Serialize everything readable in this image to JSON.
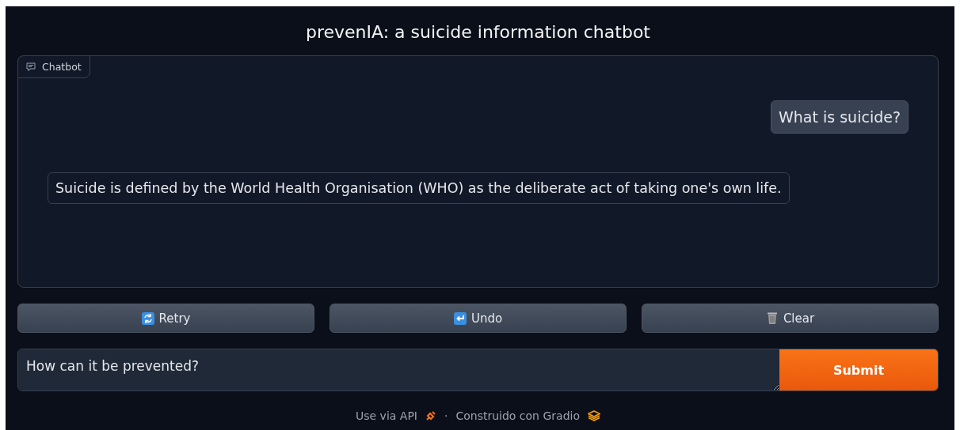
{
  "title": "prevenIA: a suicide information chatbot",
  "chatbot": {
    "label": "Chatbot",
    "messages": [
      {
        "kind": "user",
        "text": "What is suicide?"
      },
      {
        "kind": "bot",
        "text": "Suicide is defined by the World Health Organisation (WHO) as the deliberate act of taking one's own life."
      }
    ]
  },
  "buttons": [
    {
      "kind": "retry",
      "label": "Retry"
    },
    {
      "kind": "undo",
      "label": "Undo"
    },
    {
      "kind": "clear",
      "label": "Clear"
    }
  ],
  "input": {
    "value": "How can it be prevented?"
  },
  "submit": "Submit",
  "footer": {
    "api_link": "Use via API",
    "separator": "·",
    "built_with": "Construido con Gradio"
  }
}
